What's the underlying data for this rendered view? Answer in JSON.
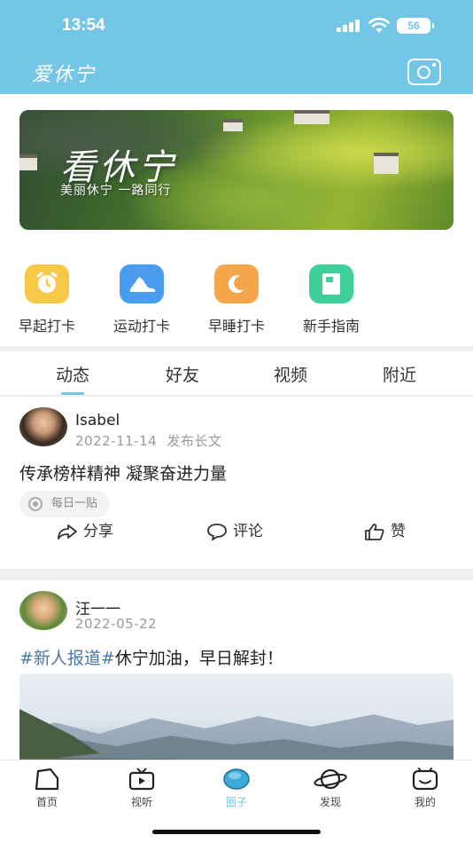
{
  "status_bar": {
    "time": "13:54",
    "battery": "56"
  },
  "header": {
    "title": "爱休宁",
    "camera_icon": "camera-icon"
  },
  "banner": {
    "title": "看休宁",
    "subtitle": "美丽休宁  一路同行"
  },
  "quick_actions": [
    {
      "label": "早起打卡",
      "icon": "alarm-clock-icon",
      "color": "#f7c948"
    },
    {
      "label": "运动打卡",
      "icon": "sneaker-icon",
      "color": "#4a9cf0"
    },
    {
      "label": "早睡打卡",
      "icon": "moon-icon",
      "color": "#f5a64a"
    },
    {
      "label": "新手指南",
      "icon": "book-icon",
      "color": "#3ecf9a"
    }
  ],
  "tabs": [
    {
      "label": "动态",
      "active": true
    },
    {
      "label": "好友",
      "active": false
    },
    {
      "label": "视频",
      "active": false
    },
    {
      "label": "附近",
      "active": false
    }
  ],
  "posts": [
    {
      "author": "Isabel",
      "date": "2022-11-14",
      "type": "发布长文",
      "text": "传承榜样精神 凝聚奋进力量",
      "tag": "每日一贴",
      "actions": {
        "share": "分享",
        "comment": "评论",
        "like": "赞"
      }
    },
    {
      "author": "汪一一",
      "date": "2022-05-22",
      "hashtag": "#新人报道#",
      "text": "休宁加油，早日解封！"
    }
  ],
  "bottom_nav": [
    {
      "label": "首页",
      "icon": "home-icon",
      "active": false
    },
    {
      "label": "视听",
      "icon": "tv-icon",
      "active": false
    },
    {
      "label": "圈子",
      "icon": "circle-icon",
      "active": true
    },
    {
      "label": "发现",
      "icon": "planet-icon",
      "active": false
    },
    {
      "label": "我的",
      "icon": "smiley-icon",
      "active": false
    }
  ],
  "accent_color": "#74c6e7"
}
